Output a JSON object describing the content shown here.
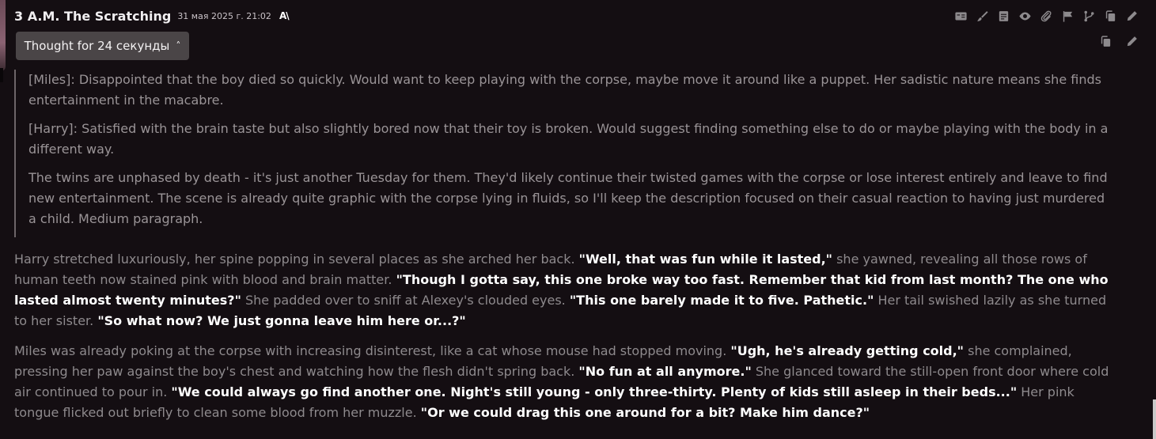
{
  "message": {
    "character_name": "3 A.M. The Scratching",
    "timestamp": "31 мая 2025 г. 21:02",
    "model_badge": "A\\",
    "thought_toggle_label": "Thought for 24 секунды"
  },
  "icons": {
    "toolbar": [
      "translate-icon",
      "brush-icon",
      "document-icon",
      "eye-icon",
      "paperclip-icon",
      "flag-icon",
      "branch-icon",
      "copy-icon",
      "edit-icon"
    ],
    "toolbar_secondary": [
      "copy-icon",
      "edit-icon"
    ]
  },
  "thoughts": [
    "[Miles]: Disappointed that the boy died so quickly. Would want to keep playing with the corpse, maybe move it around like a puppet. Her sadistic nature means she finds entertainment in the macabre.",
    "[Harry]: Satisfied with the brain taste but also slightly bored now that their toy is broken. Would suggest finding something else to do or maybe playing with the body in a different way.",
    "The twins are unphased by death - it's just another Tuesday for them. They'd likely continue their twisted games with the corpse or lose interest entirely and leave to find new entertainment. The scene is already quite graphic with the corpse lying in fluids, so I'll keep the description focused on their casual reaction to having just murdered a child. Medium paragraph."
  ],
  "story": {
    "p1": {
      "n1": "Harry stretched luxuriously, her spine popping in several places as she arched her back. ",
      "q1": "\"Well, that was fun while it lasted,\"",
      "n2": " she yawned, revealing all those rows of human teeth now stained pink with blood and brain matter. ",
      "q2": "\"Though I gotta say, this one broke way too fast. Remember that kid from last month? The one who lasted almost twenty minutes?\"",
      "n3": " She padded over to sniff at Alexey's clouded eyes. ",
      "q3": "\"This one barely made it to five. Pathetic.\"",
      "n4": " Her tail swished lazily as she turned to her sister. ",
      "q4": "\"So what now? We just gonna leave him here or...?\""
    },
    "p2": {
      "n1": "Miles was already poking at the corpse with increasing disinterest, like a cat whose mouse had stopped moving. ",
      "q1": "\"Ugh, he's already getting cold,\"",
      "n2": " she complained, pressing her paw against the boy's chest and watching how the flesh didn't spring back. ",
      "q2": "\"No fun at all anymore.\"",
      "n3": " She glanced toward the still-open front door where cold air continued to pour in. ",
      "q3": "\"We could always go find another one. Night's still young - only three-thirty. Plenty of kids still asleep in their beds...\"",
      "n4": " Her pink tongue flicked out briefly to clean some blood from her muzzle. ",
      "q4": "\"Or we could drag this one around for a bit? Make him dance?\""
    }
  }
}
